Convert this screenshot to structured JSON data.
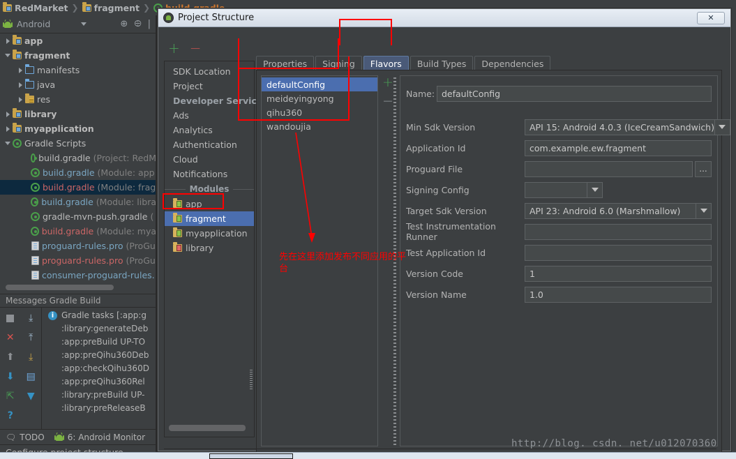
{
  "breadcrumb": [
    {
      "label": "RedMarket",
      "icon": "folder-module-icon",
      "style": "normal"
    },
    {
      "label": "fragment",
      "icon": "folder-module-icon",
      "style": "normal"
    },
    {
      "label": "build.gradle",
      "icon": "gradle-icon",
      "style": "red"
    }
  ],
  "tool_window": {
    "title": "Android",
    "icon": "android-icon",
    "buttons": [
      "target-icon",
      "collapse-all-icon"
    ]
  },
  "project_tree": [
    {
      "label": "app",
      "icon": "folder-module-icon",
      "twisty": "right",
      "depth": 0,
      "bold": true,
      "selected": false,
      "suffix": ""
    },
    {
      "label": "fragment",
      "icon": "folder-module-icon",
      "twisty": "down",
      "depth": 0,
      "bold": true,
      "selected": false,
      "suffix": ""
    },
    {
      "label": "manifests",
      "icon": "folder-plain-icon",
      "twisty": "right",
      "depth": 1,
      "bold": false,
      "selected": false,
      "suffix": ""
    },
    {
      "label": "java",
      "icon": "folder-plain-icon",
      "twisty": "right",
      "depth": 1,
      "bold": false,
      "selected": false,
      "suffix": ""
    },
    {
      "label": "res",
      "icon": "folder-res-icon",
      "twisty": "right",
      "depth": 1,
      "bold": false,
      "selected": false,
      "suffix": ""
    },
    {
      "label": "library",
      "icon": "folder-module-icon",
      "twisty": "right",
      "depth": 0,
      "bold": true,
      "selected": false,
      "suffix": ""
    },
    {
      "label": "myapplication",
      "icon": "folder-module-icon",
      "twisty": "right",
      "depth": 0,
      "bold": true,
      "selected": false,
      "suffix": ""
    },
    {
      "label": "Gradle Scripts",
      "icon": "gradle-icon",
      "twisty": "down",
      "depth": 0,
      "bold": false,
      "selected": false,
      "suffix": ""
    },
    {
      "label": "build.gradle",
      "icon": "gradle-icon",
      "twisty": "none",
      "depth": 2,
      "bold": false,
      "selected": false,
      "suffix": "(Project: RedM",
      "color": "normal"
    },
    {
      "label": "build.gradle",
      "icon": "gradle-icon",
      "twisty": "none",
      "depth": 2,
      "bold": false,
      "selected": false,
      "suffix": "(Module: app",
      "color": "blue"
    },
    {
      "label": "build.gradle",
      "icon": "gradle-icon",
      "twisty": "none",
      "depth": 2,
      "bold": false,
      "selected": true,
      "suffix": "(Module: frag",
      "color": "red"
    },
    {
      "label": "build.gradle",
      "icon": "gradle-icon",
      "twisty": "none",
      "depth": 2,
      "bold": false,
      "selected": false,
      "suffix": "(Module: libra",
      "color": "blue"
    },
    {
      "label": "gradle-mvn-push.gradle",
      "icon": "gradle-icon",
      "twisty": "none",
      "depth": 2,
      "bold": false,
      "selected": false,
      "suffix": "(",
      "color": "normal"
    },
    {
      "label": "build.gradle",
      "icon": "gradle-icon",
      "twisty": "none",
      "depth": 2,
      "bold": false,
      "selected": false,
      "suffix": "(Module: mya",
      "color": "red"
    },
    {
      "label": "proguard-rules.pro",
      "icon": "file-icon",
      "twisty": "none",
      "depth": 2,
      "bold": false,
      "selected": false,
      "suffix": "(ProGu",
      "color": "blue"
    },
    {
      "label": "proguard-rules.pro",
      "icon": "file-icon",
      "twisty": "none",
      "depth": 2,
      "bold": false,
      "selected": false,
      "suffix": "(ProGu",
      "color": "red"
    },
    {
      "label": "consumer-proguard-rules.",
      "icon": "file-icon",
      "twisty": "none",
      "depth": 2,
      "bold": false,
      "selected": false,
      "suffix": "",
      "color": "blue"
    }
  ],
  "messages": {
    "title": "Messages Gradle Build",
    "gutter_icons": [
      "stop-icon",
      "expand-all-icon",
      "close-icon",
      "collapse-all-icon",
      "up-arrow-icon",
      "export-icon",
      "down-arrow-icon",
      "console-icon",
      "jump-icon",
      "filter-icon",
      "help-icon"
    ],
    "rows": [
      {
        "text": "Gradle tasks [:app:g",
        "icon": "info-icon",
        "indent": false
      },
      {
        "text": ":library:generateDeb",
        "icon": "",
        "indent": true
      },
      {
        "text": ":app:preBuild UP-TO",
        "icon": "",
        "indent": true
      },
      {
        "text": ":app:preQihu360Deb",
        "icon": "",
        "indent": true
      },
      {
        "text": ":app:checkQihu360D",
        "icon": "",
        "indent": true
      },
      {
        "text": ":app:preQihu360Rel",
        "icon": "",
        "indent": true
      },
      {
        "text": ":library:preBuild UP-",
        "icon": "",
        "indent": true
      },
      {
        "text": ":library:preReleaseB",
        "icon": "",
        "indent": true
      }
    ]
  },
  "bottom_strip": [
    {
      "label": "TODO",
      "icon": "todo-icon"
    },
    {
      "label": "6: Android Monitor",
      "icon": "android-icon"
    }
  ],
  "status_bar": {
    "text": "Configure project structure"
  },
  "dialog": {
    "title": "Project Structure",
    "icon": "android-studio-icon",
    "close_label": "✕",
    "add_label": "+",
    "remove_label": "−",
    "nav": [
      {
        "label": "SDK Location",
        "type": "item",
        "selected": false,
        "icon": ""
      },
      {
        "label": "Project",
        "type": "item",
        "selected": false,
        "icon": ""
      },
      {
        "label": "Developer Services",
        "type": "header",
        "selected": false,
        "icon": ""
      },
      {
        "label": "Ads",
        "type": "item",
        "selected": false,
        "icon": ""
      },
      {
        "label": "Analytics",
        "type": "item",
        "selected": false,
        "icon": ""
      },
      {
        "label": "Authentication",
        "type": "item",
        "selected": false,
        "icon": ""
      },
      {
        "label": "Cloud",
        "type": "item",
        "selected": false,
        "icon": ""
      },
      {
        "label": "Notifications",
        "type": "item",
        "selected": false,
        "icon": ""
      },
      {
        "label": "Modules",
        "type": "group",
        "selected": false,
        "icon": ""
      },
      {
        "label": "app",
        "type": "module",
        "selected": false,
        "icon": "module-icon"
      },
      {
        "label": "fragment",
        "type": "module",
        "selected": true,
        "icon": "module-icon"
      },
      {
        "label": "myapplication",
        "type": "module",
        "selected": false,
        "icon": "module-icon"
      },
      {
        "label": "library",
        "type": "module",
        "selected": false,
        "icon": "library-icon"
      }
    ],
    "tabs": [
      {
        "label": "Properties",
        "active": false
      },
      {
        "label": "Signing",
        "active": false
      },
      {
        "label": "Flavors",
        "active": true
      },
      {
        "label": "Build Types",
        "active": false
      },
      {
        "label": "Dependencies",
        "active": false
      }
    ],
    "flavors": [
      {
        "label": "defaultConfig",
        "selected": true
      },
      {
        "label": "meideyingyong",
        "selected": false
      },
      {
        "label": "qihu360",
        "selected": false
      },
      {
        "label": "wandoujia",
        "selected": false
      }
    ],
    "flavor_add_label": "+",
    "flavor_remove_label": "−",
    "form": [
      {
        "label": "Name:",
        "value": "defaultConfig",
        "control": "text",
        "name_row": true
      },
      {
        "label": "Min Sdk Version",
        "value": "API 15: Android 4.0.3 (IceCreamSandwich)",
        "control": "combo"
      },
      {
        "label": "Application Id",
        "value": "com.example.ew.fragment",
        "control": "text"
      },
      {
        "label": "Proguard File",
        "value": "",
        "control": "text-browse",
        "browse_label": "..."
      },
      {
        "label": "Signing Config",
        "value": "",
        "control": "combo-short"
      },
      {
        "label": "Target Sdk Version",
        "value": "API 23: Android 6.0 (Marshmallow)",
        "control": "combo"
      },
      {
        "label": "Test Instrumentation Runner",
        "value": "",
        "control": "text"
      },
      {
        "label": "Test Application Id",
        "value": "",
        "control": "text"
      },
      {
        "label": "Version Code",
        "value": "1",
        "control": "text"
      },
      {
        "label": "Version Name",
        "value": "1.0",
        "control": "text"
      }
    ]
  },
  "annotation": {
    "text": "先在这里添加发布不同应用的平台",
    "color": "#ff0000"
  },
  "watermark": {
    "text": "http://blog. csdn. net/u012070360"
  }
}
